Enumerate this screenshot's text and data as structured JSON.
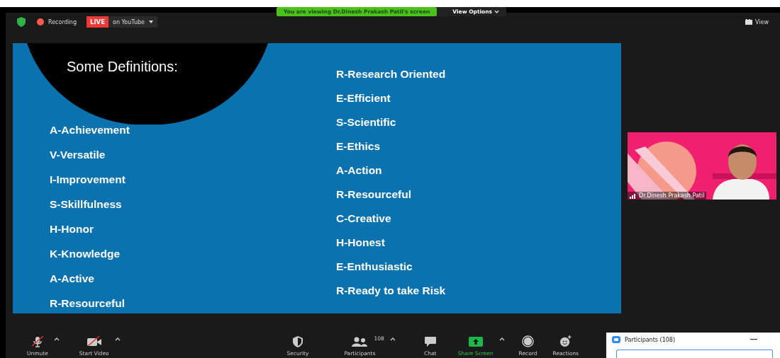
{
  "top_bar": {
    "recording": "Recording",
    "live": "LIVE",
    "stream": "on YouTube",
    "banner": "You are viewing Dr.Dinesh Prakash Patil's screen",
    "view_options": "View Options",
    "view": "View"
  },
  "slide": {
    "title": "Some Definitions:",
    "left": [
      "A-Achievement",
      "V-Versatile",
      "I-Improvement",
      "S-Skillfulness",
      "H-Honor",
      "K-Knowledge",
      "A-Active",
      "R-Resourceful"
    ],
    "right": [
      "R-Research Oriented",
      "E-Efficient",
      "S-Scientific",
      "E-Ethics",
      "A-Action",
      "R-Resourceful",
      "C-Creative",
      "H-Honest",
      "E-Enthusiastic",
      "R-Ready to take Risk"
    ]
  },
  "video_tile": {
    "name": "Dr.Dinesh Prakash Patil"
  },
  "toolbar": [
    {
      "kind": "mic",
      "label": "Unmute",
      "off": true,
      "caret": true
    },
    {
      "kind": "video",
      "label": "Start Video",
      "off": true,
      "caret": true
    },
    {
      "kind": "security",
      "label": "Security",
      "off": false,
      "caret": false
    },
    {
      "kind": "participants",
      "label": "Participants",
      "count": "108",
      "off": false,
      "caret": true
    },
    {
      "kind": "chat",
      "label": "Chat",
      "off": false,
      "caret": false
    },
    {
      "kind": "share",
      "label": "Share Screen",
      "off": false,
      "caret": true
    },
    {
      "kind": "record",
      "label": "Record",
      "off": false,
      "caret": false
    },
    {
      "kind": "reactions",
      "label": "Reactions",
      "off": false,
      "caret": false
    }
  ],
  "participants_panel": {
    "title": "Participants (108)"
  }
}
